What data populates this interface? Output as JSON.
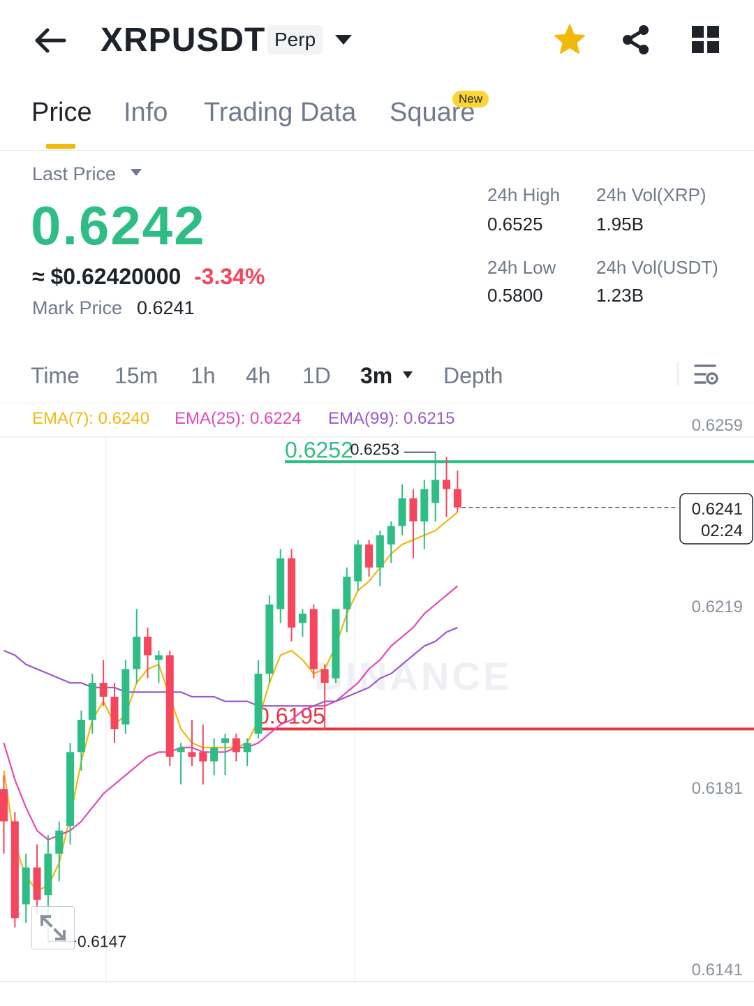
{
  "header": {
    "symbol": "XRPUSDT",
    "contract_badge": "Perp",
    "icons": [
      "back-arrow-icon",
      "caret-down-icon",
      "star-icon",
      "share-icon",
      "grid-menu-icon"
    ],
    "favorite_color": "#F0B90B"
  },
  "tabs": [
    {
      "label": "Price",
      "active": true
    },
    {
      "label": "Info",
      "active": false
    },
    {
      "label": "Trading Data",
      "active": false
    },
    {
      "label": "Square",
      "active": false,
      "badge": "New"
    }
  ],
  "price": {
    "last_label": "Last Price",
    "last_value": "0.6242",
    "fiat_value": "≈ $0.62420000",
    "change_pct": "-3.34%",
    "mark_label": "Mark Price",
    "mark_value": "0.6241",
    "up_color": "#2EBD85",
    "down_color": "#F6465D"
  },
  "stats": {
    "high_label": "24h High",
    "high_value": "0.6525",
    "low_label": "24h Low",
    "low_value": "0.5800",
    "vol_base_label": "24h Vol(XRP)",
    "vol_base_value": "1.95B",
    "vol_quote_label": "24h Vol(USDT)",
    "vol_quote_value": "1.23B"
  },
  "intervals": {
    "items": [
      "Time",
      "15m",
      "1h",
      "4h",
      "1D",
      "3m",
      "Depth"
    ],
    "selected": "3m"
  },
  "indicators": {
    "ema7": "EMA(7): 0.6240",
    "ema25": "EMA(25): 0.6224",
    "ema99": "EMA(99): 0.6215"
  },
  "chart_data": {
    "type": "candlestick",
    "price_axis_ticks": [
      "0.6259",
      "0.6219",
      "0.6181",
      "0.6141"
    ],
    "current_price_tag": {
      "price": "0.6241",
      "countdown": "02:24",
      "value": 0.6241
    },
    "resistance_line": {
      "value": 0.6252,
      "label": "0.6252",
      "color": "#2EBD85"
    },
    "support_line": {
      "value": 0.6193,
      "label": "0.6195",
      "color": "#E8333F"
    },
    "high_marker": {
      "value": 0.6253,
      "label": "0.6253"
    },
    "low_marker": {
      "value": 0.6147,
      "label": "0.6147"
    },
    "watermark": "BINANCE",
    "candles": [
      {
        "o": 0.618,
        "c": 0.6173,
        "h": 0.6183,
        "l": 0.6166
      },
      {
        "o": 0.6173,
        "c": 0.6152,
        "h": 0.6175,
        "l": 0.615
      },
      {
        "o": 0.6155,
        "c": 0.6163,
        "h": 0.6166,
        "l": 0.6151
      },
      {
        "o": 0.6163,
        "c": 0.6156,
        "h": 0.6168,
        "l": 0.6153
      },
      {
        "o": 0.6157,
        "c": 0.6166,
        "h": 0.617,
        "l": 0.6147
      },
      {
        "o": 0.6166,
        "c": 0.6171,
        "h": 0.6173,
        "l": 0.616
      },
      {
        "o": 0.6172,
        "c": 0.6188,
        "h": 0.619,
        "l": 0.6168
      },
      {
        "o": 0.6188,
        "c": 0.6195,
        "h": 0.6197,
        "l": 0.6184
      },
      {
        "o": 0.6195,
        "c": 0.6203,
        "h": 0.6205,
        "l": 0.6192
      },
      {
        "o": 0.6203,
        "c": 0.62,
        "h": 0.6208,
        "l": 0.6198
      },
      {
        "o": 0.62,
        "c": 0.6193,
        "h": 0.6203,
        "l": 0.619
      },
      {
        "o": 0.6194,
        "c": 0.6206,
        "h": 0.6208,
        "l": 0.6192
      },
      {
        "o": 0.6206,
        "c": 0.6213,
        "h": 0.6219,
        "l": 0.6203
      },
      {
        "o": 0.6213,
        "c": 0.6209,
        "h": 0.6215,
        "l": 0.6204
      },
      {
        "o": 0.6208,
        "c": 0.6209,
        "h": 0.621,
        "l": 0.6203
      },
      {
        "o": 0.6209,
        "c": 0.6187,
        "h": 0.621,
        "l": 0.6185
      },
      {
        "o": 0.6188,
        "c": 0.6189,
        "h": 0.619,
        "l": 0.6181
      },
      {
        "o": 0.6188,
        "c": 0.6187,
        "h": 0.6195,
        "l": 0.6185
      },
      {
        "o": 0.6188,
        "c": 0.6186,
        "h": 0.6194,
        "l": 0.6181
      },
      {
        "o": 0.6186,
        "c": 0.6189,
        "h": 0.6191,
        "l": 0.6183
      },
      {
        "o": 0.619,
        "c": 0.6191,
        "h": 0.6192,
        "l": 0.6183
      },
      {
        "o": 0.6191,
        "c": 0.6188,
        "h": 0.6192,
        "l": 0.6186
      },
      {
        "o": 0.6188,
        "c": 0.619,
        "h": 0.6191,
        "l": 0.6185
      },
      {
        "o": 0.6192,
        "c": 0.6205,
        "h": 0.6208,
        "l": 0.6191
      },
      {
        "o": 0.6205,
        "c": 0.622,
        "h": 0.6222,
        "l": 0.6203
      },
      {
        "o": 0.6219,
        "c": 0.623,
        "h": 0.6232,
        "l": 0.6216
      },
      {
        "o": 0.623,
        "c": 0.6215,
        "h": 0.6232,
        "l": 0.6212
      },
      {
        "o": 0.6216,
        "c": 0.6218,
        "h": 0.6219,
        "l": 0.6213
      },
      {
        "o": 0.6219,
        "c": 0.6206,
        "h": 0.622,
        "l": 0.6204
      },
      {
        "o": 0.6206,
        "c": 0.6203,
        "h": 0.6207,
        "l": 0.6193
      },
      {
        "o": 0.6204,
        "c": 0.6219,
        "h": 0.6219,
        "l": 0.6203
      },
      {
        "o": 0.6219,
        "c": 0.6226,
        "h": 0.6228,
        "l": 0.6214
      },
      {
        "o": 0.6225,
        "c": 0.6233,
        "h": 0.6234,
        "l": 0.6223
      },
      {
        "o": 0.6233,
        "c": 0.6228,
        "h": 0.6234,
        "l": 0.6226
      },
      {
        "o": 0.6228,
        "c": 0.6235,
        "h": 0.6236,
        "l": 0.6224
      },
      {
        "o": 0.6233,
        "c": 0.6237,
        "h": 0.6238,
        "l": 0.6229
      },
      {
        "o": 0.6237,
        "c": 0.6243,
        "h": 0.6246,
        "l": 0.6235
      },
      {
        "o": 0.6243,
        "c": 0.6238,
        "h": 0.6245,
        "l": 0.623
      },
      {
        "o": 0.6238,
        "c": 0.6245,
        "h": 0.6247,
        "l": 0.6232
      },
      {
        "o": 0.6242,
        "c": 0.6247,
        "h": 0.6253,
        "l": 0.6238
      },
      {
        "o": 0.6247,
        "c": 0.6245,
        "h": 0.6252,
        "l": 0.6239
      },
      {
        "o": 0.6245,
        "c": 0.6241,
        "h": 0.6249,
        "l": 0.624
      }
    ],
    "ema_series": [
      {
        "name": "EMA(7)",
        "color": "#F0B90B",
        "values": [
          0.6184,
          0.6168,
          0.6161,
          0.6158,
          0.6159,
          0.6164,
          0.6174,
          0.6186,
          0.6195,
          0.6199,
          0.6194,
          0.6196,
          0.6203,
          0.6206,
          0.6207,
          0.62,
          0.6193,
          0.619,
          0.6189,
          0.6189,
          0.6189,
          0.6189,
          0.619,
          0.6195,
          0.6203,
          0.6209,
          0.621,
          0.6208,
          0.6205,
          0.6206,
          0.6211,
          0.6218,
          0.6223,
          0.6225,
          0.6228,
          0.6231,
          0.6233,
          0.6234,
          0.6235,
          0.6236,
          0.6238,
          0.624
        ]
      },
      {
        "name": "EMA(25)",
        "color": "#E04AB8",
        "values": [
          0.619,
          0.6182,
          0.6176,
          0.6171,
          0.6169,
          0.617,
          0.6171,
          0.6173,
          0.6176,
          0.6179,
          0.6181,
          0.6183,
          0.6185,
          0.6187,
          0.6188,
          0.6188,
          0.6189,
          0.6189,
          0.6188,
          0.6188,
          0.6188,
          0.6189,
          0.6189,
          0.619,
          0.6192,
          0.6194,
          0.6195,
          0.6197,
          0.6198,
          0.6198,
          0.6199,
          0.6201,
          0.6203,
          0.6206,
          0.6208,
          0.6211,
          0.6213,
          0.6215,
          0.6218,
          0.622,
          0.6222,
          0.6224
        ]
      },
      {
        "name": "EMA(99)",
        "color": "#9B59C9",
        "values": [
          0.621,
          0.6209,
          0.6207,
          0.6206,
          0.6205,
          0.6204,
          0.6203,
          0.6203,
          0.6202,
          0.6202,
          0.6202,
          0.6201,
          0.6201,
          0.6201,
          0.6201,
          0.6201,
          0.6201,
          0.62,
          0.62,
          0.62,
          0.6199,
          0.6199,
          0.6199,
          0.6198,
          0.6198,
          0.6198,
          0.6198,
          0.6198,
          0.6198,
          0.6199,
          0.6199,
          0.62,
          0.6201,
          0.6202,
          0.6204,
          0.6205,
          0.6207,
          0.6209,
          0.6211,
          0.6212,
          0.6214,
          0.6215
        ]
      }
    ]
  }
}
